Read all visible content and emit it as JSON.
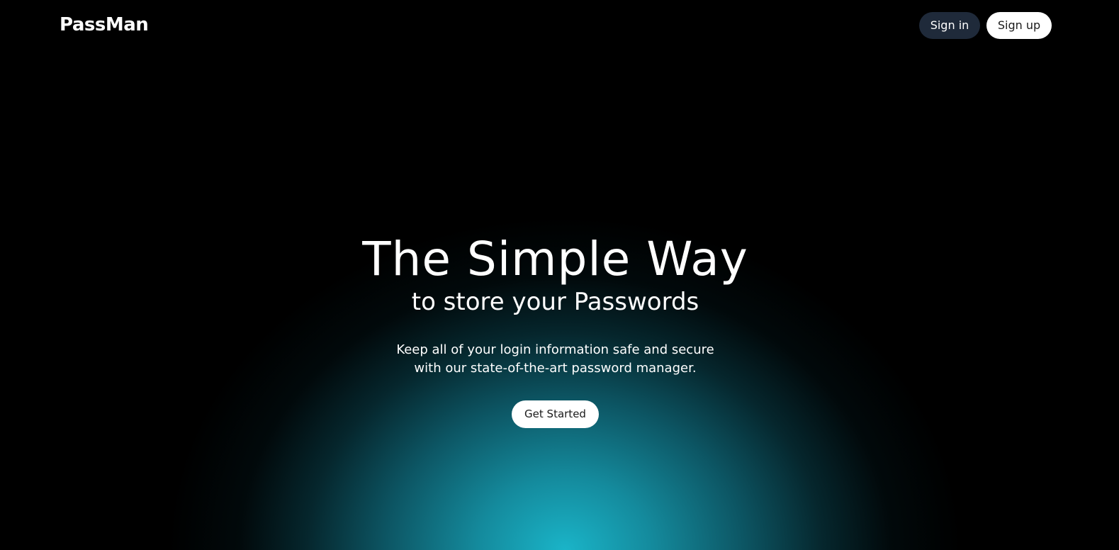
{
  "header": {
    "logo": "PassMan",
    "sign_in_label": "Sign in",
    "sign_up_label": "Sign up"
  },
  "hero": {
    "title": "The Simple Way",
    "subtitle": "to store your Passwords",
    "description_line1": "Keep all of your login information safe and secure",
    "description_line2": "with our state-of-the-art password manager.",
    "cta_label": "Get Started"
  },
  "colors": {
    "background": "#000000",
    "glow": "#1ab4c8",
    "sign_in_bg": "#1f2a3a",
    "button_light": "#ffffff"
  }
}
